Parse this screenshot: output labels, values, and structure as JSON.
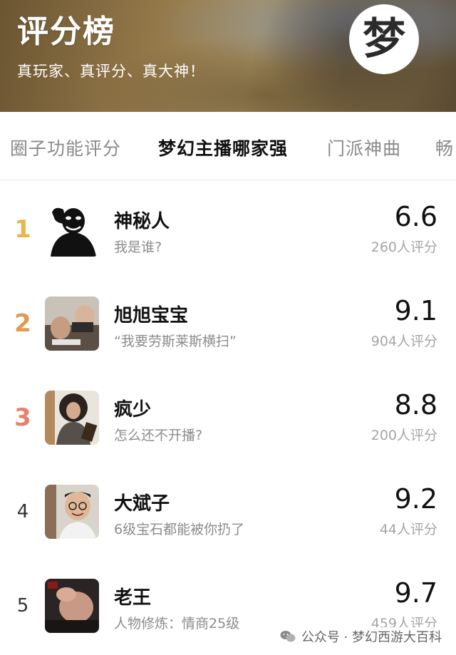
{
  "banner": {
    "title": "评分榜",
    "subtitle": "真玩家、真评分、真大神！",
    "logo_text": "梦"
  },
  "tabs": [
    {
      "label": "圈子功能评分",
      "active": false
    },
    {
      "label": "梦幻主播哪家强",
      "active": true
    },
    {
      "label": "门派神曲",
      "active": false
    },
    {
      "label": "畅",
      "active": false
    }
  ],
  "list": [
    {
      "rank": "1",
      "name": "神秘人",
      "desc": "我是谁?",
      "score": "6.6",
      "count": "260人评分",
      "rank_color": "#e8b74a",
      "avatar": "mystery-figure"
    },
    {
      "rank": "2",
      "name": "旭旭宝宝",
      "desc": "“我要劳斯莱斯横扫”",
      "score": "9.1",
      "count": "904人评分",
      "rank_color": "#e09a52",
      "avatar": "photo-streamer"
    },
    {
      "rank": "3",
      "name": "疯少",
      "desc": "怎么还不开播?",
      "score": "8.8",
      "count": "200人评分",
      "rank_color": "#e8806c",
      "avatar": "photo-longhair"
    },
    {
      "rank": "4",
      "name": "大斌子",
      "desc": "6级宝石都能被你扔了",
      "score": "9.2",
      "count": "44人评分",
      "rank_color": "#333333",
      "avatar": "photo-glasses"
    },
    {
      "rank": "5",
      "name": "老王",
      "desc": "人物修炼：情商25级",
      "score": "9.7",
      "count": "459人评分",
      "rank_color": "#333333",
      "avatar": "photo-dark"
    }
  ],
  "watermark": {
    "text": "公众号 · 梦幻西游大百科",
    "icon": "wechat-icon"
  }
}
